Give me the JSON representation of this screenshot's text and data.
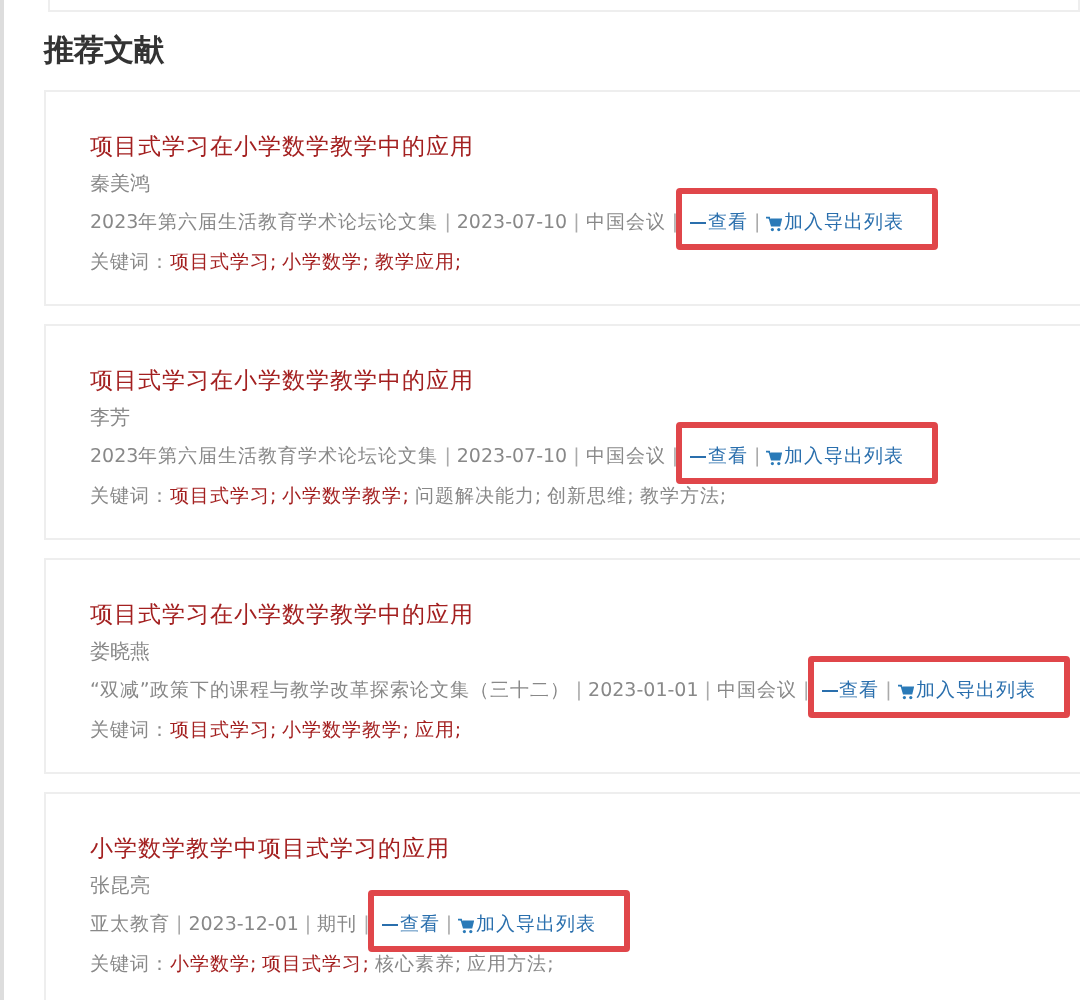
{
  "section_title": "推荐文献",
  "results": [
    {
      "title": "项目式学习在小学数学教学中的应用",
      "author": "秦美鸿",
      "source": "2023年第六届生活教育学术论坛论文集",
      "date": "2023-07-10",
      "type": "中国会议",
      "separators": [
        "|",
        "|",
        "|",
        "|"
      ],
      "view_link": "查看",
      "export_link": "加入导出列表",
      "keywords_label": "关键词：",
      "keywords": [
        {
          "text": "项目式学习;",
          "matched": true
        },
        {
          "text": "小学数学;",
          "matched": true
        },
        {
          "text": "教学应用;",
          "matched": true
        }
      ]
    },
    {
      "title": "项目式学习在小学数学教学中的应用",
      "author": "李芳",
      "source": "2023年第六届生活教育学术论坛论文集",
      "date": "2023-07-10",
      "type": "中国会议",
      "separators": [
        "|",
        "|",
        "|",
        "|"
      ],
      "view_link": "查看",
      "export_link": "加入导出列表",
      "keywords_label": "关键词：",
      "keywords": [
        {
          "text": "项目式学习;",
          "matched": true
        },
        {
          "text": "小学数学教学;",
          "matched": true
        },
        {
          "text": "问题解决能力;",
          "matched": false
        },
        {
          "text": "创新思维;",
          "matched": false
        },
        {
          "text": "教学方法;",
          "matched": false
        }
      ]
    },
    {
      "title": "项目式学习在小学数学教学中的应用",
      "author": "娄晓燕",
      "source": "“双减”政策下的课程与教学改革探索论文集（三十二）",
      "date": "2023-01-01",
      "type": "中国会议",
      "separators": [
        "|",
        "|",
        "|",
        "|"
      ],
      "view_link": "查看",
      "export_link": "加入导出列表",
      "keywords_label": "关键词：",
      "keywords": [
        {
          "text": "项目式学习;",
          "matched": true
        },
        {
          "text": "小学数学教学;",
          "matched": true
        },
        {
          "text": "应用;",
          "matched": true
        }
      ]
    },
    {
      "title": "小学数学教学中项目式学习的应用",
      "author": "张昆亮",
      "source": "亚太教育",
      "date": "2023-12-01",
      "type": "期刊",
      "separators": [
        "|",
        "|",
        "|",
        "|"
      ],
      "view_link": "查看",
      "export_link": "加入导出列表",
      "keywords_label": "关键词：",
      "keywords": [
        {
          "text": "小学数学;",
          "matched": true
        },
        {
          "text": "项目式学习;",
          "matched": true
        },
        {
          "text": "核心素养;",
          "matched": false
        },
        {
          "text": "应用方法;",
          "matched": false
        }
      ]
    }
  ]
}
